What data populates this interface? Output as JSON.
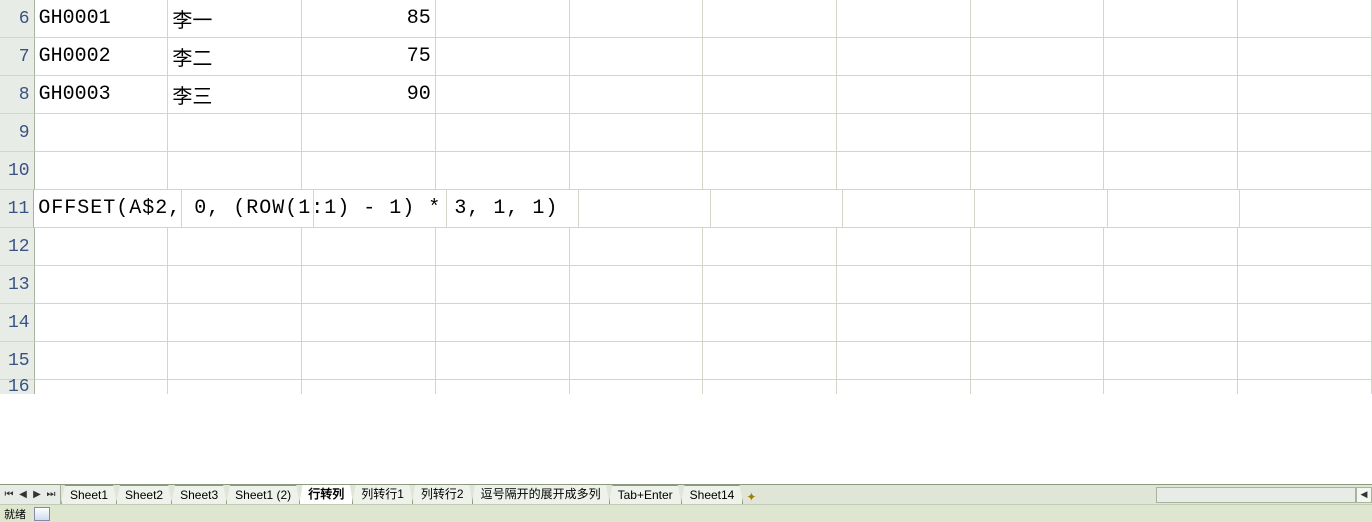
{
  "rows": {
    "6": {
      "hdr": "6",
      "a": "GH0001",
      "b": "李一",
      "c": "85"
    },
    "7": {
      "hdr": "7",
      "a": "GH0002",
      "b": "李二",
      "c": "75"
    },
    "8": {
      "hdr": "8",
      "a": "GH0003",
      "b": "李三",
      "c": "90"
    },
    "9": {
      "hdr": "9",
      "a": "",
      "b": "",
      "c": ""
    },
    "10": {
      "hdr": "10",
      "a": "",
      "b": "",
      "c": ""
    },
    "11": {
      "hdr": "11",
      "a": "OFFSET(A$2, 0, (ROW(1:1) - 1) * 3, 1, 1)",
      "b": "",
      "c": ""
    },
    "12": {
      "hdr": "12",
      "a": "",
      "b": "",
      "c": ""
    },
    "13": {
      "hdr": "13",
      "a": "",
      "b": "",
      "c": ""
    },
    "14": {
      "hdr": "14",
      "a": "",
      "b": "",
      "c": ""
    },
    "15": {
      "hdr": "15",
      "a": "",
      "b": "",
      "c": ""
    },
    "16": {
      "hdr": "16",
      "a": "",
      "b": "",
      "c": ""
    }
  },
  "tabs": [
    {
      "label": "Sheet1",
      "active": false
    },
    {
      "label": "Sheet2",
      "active": false
    },
    {
      "label": "Sheet3",
      "active": false
    },
    {
      "label": "Sheet1 (2)",
      "active": false
    },
    {
      "label": "行转列",
      "active": true
    },
    {
      "label": "列转行1",
      "active": false
    },
    {
      "label": "列转行2",
      "active": false
    },
    {
      "label": "逗号隔开的展开成多列",
      "active": false
    },
    {
      "label": "Tab+Enter",
      "active": false
    },
    {
      "label": "Sheet14",
      "active": false
    }
  ],
  "nav": {
    "first": "⏮",
    "prev": "◀",
    "next": "▶",
    "last": "⏭"
  },
  "status": {
    "text": "就绪"
  }
}
